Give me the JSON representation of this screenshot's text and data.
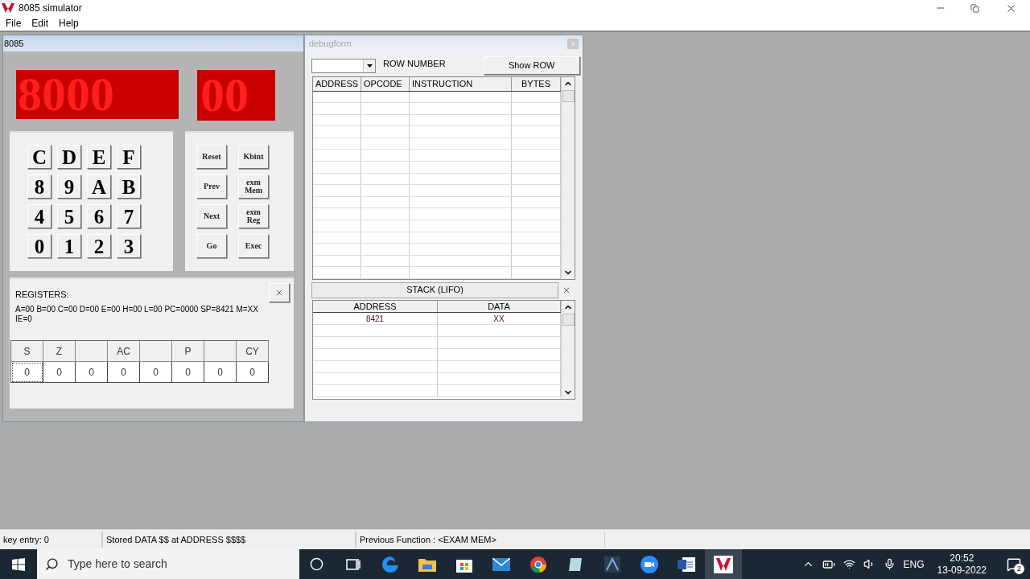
{
  "window": {
    "title": "8085 simulator"
  },
  "menu": [
    "File",
    "Edit",
    "Help"
  ],
  "kit_window": {
    "title": "8085",
    "address_display": "8000",
    "data_display": "00",
    "keypad": [
      [
        "C",
        "D",
        "E",
        "F"
      ],
      [
        "8",
        "9",
        "A",
        "B"
      ],
      [
        "4",
        "5",
        "6",
        "7"
      ],
      [
        "0",
        "1",
        "2",
        "3"
      ]
    ],
    "function_keys": [
      [
        "Reset",
        "Kbint"
      ],
      [
        "Prev",
        "exm Mem"
      ],
      [
        "Next",
        "exm Reg"
      ],
      [
        "Go",
        "Exec"
      ]
    ],
    "registers": {
      "title": "REGISTERS:",
      "values": "A=00 B=00 C=00 D=00 E=00 H=00 L=00 PC=0000 SP=8421 M=XX IE=0",
      "flags": [
        {
          "label": "S",
          "value": "0"
        },
        {
          "label": "Z",
          "value": "0"
        },
        {
          "value": "0"
        },
        {
          "label": "AC",
          "value": "0"
        },
        {
          "value": "0"
        },
        {
          "label": "P",
          "value": "0"
        },
        {
          "value": "0"
        },
        {
          "label": "CY",
          "value": "0"
        }
      ]
    }
  },
  "debug_window": {
    "title": "debugform",
    "row_label": "ROW NUMBER",
    "show_button": "Show ROW",
    "columns": [
      "ADDRESS",
      "OPCODE",
      "INSTRUCTION",
      "BYTES"
    ],
    "stack": {
      "title": "STACK (LIFO)",
      "columns": [
        "ADDRESS",
        "DATA"
      ],
      "rows": [
        [
          "8421",
          "XX"
        ]
      ]
    }
  },
  "status_bar": [
    "key entry: 0",
    "Stored DATA $$ at ADDRESS $$$$",
    "Previous Function : <EXAM MEM>"
  ],
  "taskbar": {
    "search_placeholder": "Type here to search",
    "language": "ENG",
    "time": "20:52",
    "date": "13-09-2022",
    "notifications": "2"
  }
}
